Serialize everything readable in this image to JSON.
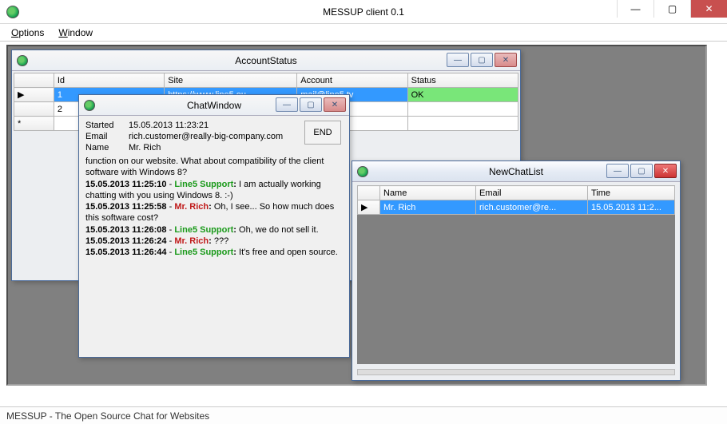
{
  "app": {
    "title": "MESSUP client 0.1",
    "statusbar": "MESSUP - The Open Source Chat for Websites"
  },
  "menu": {
    "options": "Options",
    "window": "Window"
  },
  "account_status": {
    "title": "AccountStatus",
    "headers": {
      "id": "Id",
      "site": "Site",
      "account": "Account",
      "status": "Status"
    },
    "rows": [
      {
        "marker": "▶",
        "id": "1",
        "site": "https://www.line5.eu...",
        "account": "mail@line5.tv",
        "status": "OK",
        "selected": true,
        "ok": true
      },
      {
        "marker": "",
        "id": "2",
        "site": "",
        "account": "",
        "status": ""
      },
      {
        "marker": "*",
        "id": "",
        "site": "",
        "account": "",
        "status": ""
      }
    ]
  },
  "chat_window": {
    "title": "ChatWindow",
    "end_label": "END",
    "labels": {
      "started": "Started",
      "email": "Email",
      "name": "Name"
    },
    "meta": {
      "started": "15.05.2013 11:23:21",
      "email": "rich.customer@really-big-company.com",
      "name": "Mr. Rich"
    },
    "intro": "function on our website. What about compatibility of the client software with Windows 8?",
    "messages": [
      {
        "ts": "15.05.2013 11:25:10",
        "user": "Line5 Support",
        "role": "support",
        "text": "I am actually working chatting with you using Windows 8. :-)"
      },
      {
        "ts": "15.05.2013 11:25:58",
        "user": "Mr. Rich",
        "role": "customer",
        "text": "Oh, I see... So how much does this software cost?"
      },
      {
        "ts": "15.05.2013 11:26:08",
        "user": "Line5 Support",
        "role": "support",
        "text": "Oh, we do not sell it."
      },
      {
        "ts": "15.05.2013 11:26:24",
        "user": "Mr. Rich",
        "role": "customer",
        "text": "???"
      },
      {
        "ts": "15.05.2013 11:26:44",
        "user": "Line5 Support",
        "role": "support",
        "text": "It's free and open source."
      }
    ]
  },
  "new_chat_list": {
    "title": "NewChatList",
    "headers": {
      "name": "Name",
      "email": "Email",
      "time": "Time"
    },
    "rows": [
      {
        "marker": "▶",
        "name": "Mr. Rich",
        "email": "rich.customer@re...",
        "time": "15.05.2013 11:2...",
        "selected": true
      }
    ]
  }
}
